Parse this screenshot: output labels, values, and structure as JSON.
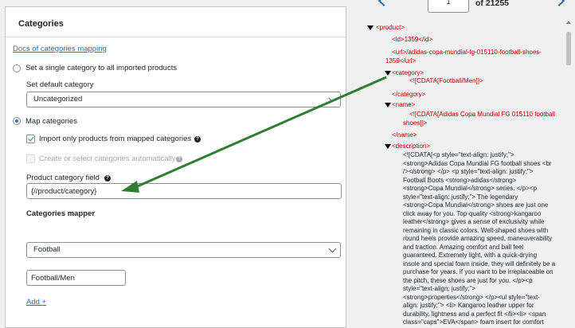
{
  "panel": {
    "title": "Categories",
    "docs_link": "Docs of categories mapping",
    "radio_single": "Set a single category to all imported products",
    "default_category_label": "Set default category",
    "default_category_value": "Uncategorized",
    "radio_map": "Map categories",
    "checkbox_import_only": "Import only products from mapped categories",
    "checkbox_create": "Create or select categories automatically",
    "product_category_field_label": "Product category field",
    "product_category_field_value": "{//product/category}",
    "mapper_title": "Categories mapper",
    "mapper_select_value": "Football",
    "mapper_input_value": "Football/Men",
    "add_link": "Add +"
  },
  "pager": {
    "current": "1",
    "total": "of 21255"
  },
  "xml": {
    "product_open": "<product>",
    "id_line": "<id>1359</id>",
    "url_line1": "<url>/adidas-copa-mundial-fg-015110-football-shoes-",
    "url_line2": "1359</url>",
    "category_open": "<category>",
    "category_cdata": "<![CDATA[Football/Men]]>",
    "category_close": "</category>",
    "name_open": "<name>",
    "name_cdata1": "<![CDATA[Adidas Copa Mundial FG 015110 football",
    "name_cdata2": "shoes]]>",
    "name_close": "</name>",
    "description_open": "<description>",
    "description_lines": [
      "<![CDATA[<p style=\"text-align: justify;\">",
      "<strong>Adidas Copa Mundial FG football shoes <br",
      "/></strong> </p> <p style=\"text-align: justify;\">",
      "Football Boots <strong>adidas</strong>",
      "<strong>Copa Mundial</strong> series. </p><p",
      "style=\"text-align: justify;\"> The legendary",
      "<strong>Copa Mundial</strong> shoes are just one",
      "click away for you. Top-quality <strong>kangaroo",
      "leather</strong> gives a sense of exclusivity while",
      "remaining in classic colors. Well-shaped shoes with",
      "round heels provide amazing speed, maneuverability",
      "and traction. Amazing comfort and ball feel",
      "guaranteed. Extremely light, with a quick-drying",
      "insole and special foam inside, they will definitely be a",
      "purchase for years. If you want to be irreplaceable on",
      "the pitch, these shoes are just for you. </p><p",
      "style=\"text-align: justify;\">",
      "<strong>properties</strong> </p><ul style=\"text-",
      "align: justify;\"> <li> Kangaroo leather upper for",
      "durability, lightness and a perfect fit </li><li> <span",
      "class=\"caps\">EVA</span> foam insert for comfort"
    ]
  },
  "colors": {
    "accent": "#2271b1",
    "arrow": "#2e7d32",
    "xml_tag": "#c00000"
  }
}
